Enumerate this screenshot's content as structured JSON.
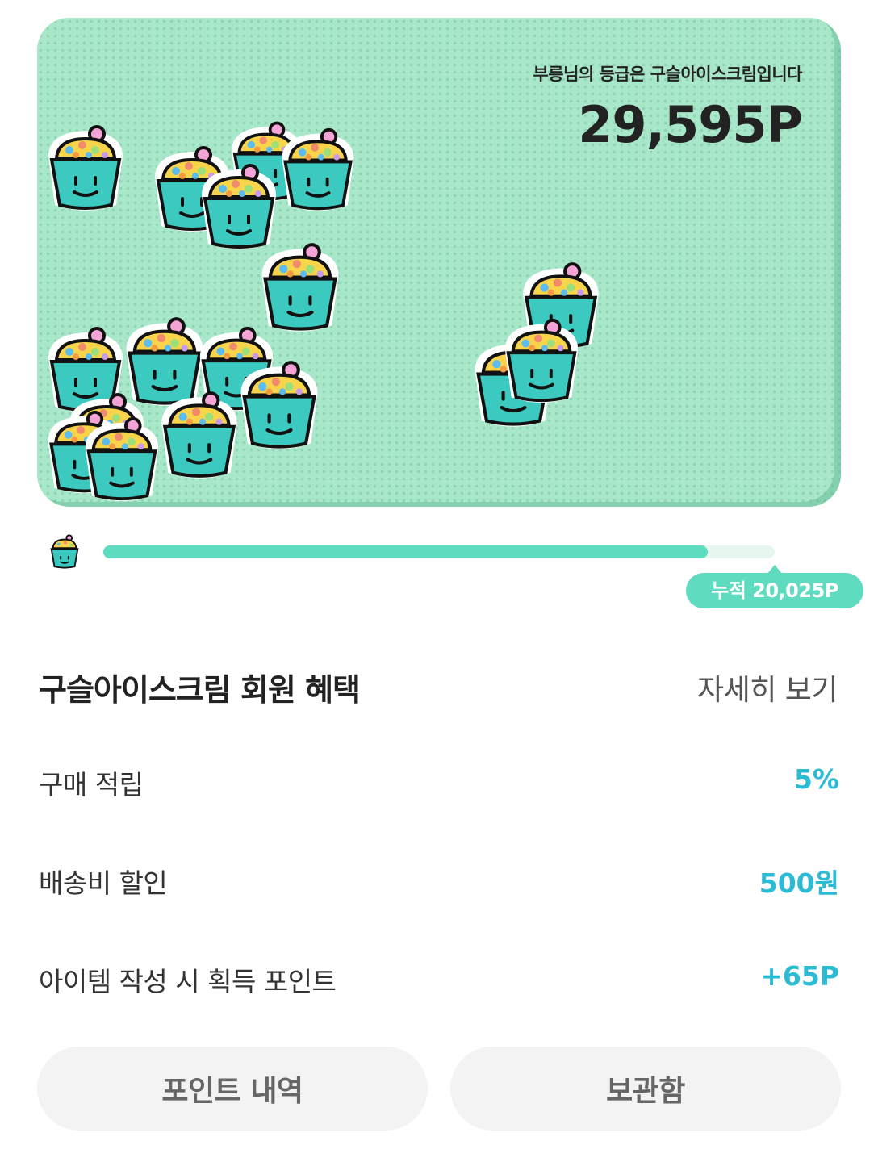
{
  "header": {
    "grade_text": "부릉님의 등급은 구슬아이스크림입니다",
    "points": "29,595P"
  },
  "progress": {
    "fill_fraction": 0.9,
    "cumulative_label": "누적 20,025P"
  },
  "benefits": {
    "title": "구슬아이스크림 회원 혜택",
    "more_label": "자세히 보기",
    "items": [
      {
        "label": "구매 적립",
        "value": "5%"
      },
      {
        "label": "배송비 할인",
        "value": "500원"
      },
      {
        "label": "아이템 작성 시 획득 포인트",
        "value": "+65P"
      }
    ]
  },
  "buttons": {
    "history_label": "포인트 내역",
    "storage_label": "보관함"
  },
  "icons": {
    "cup": "ice-cream-cup-icon"
  },
  "colors": {
    "card_bg": "#a8e7c9",
    "accent": "#5fdcbf",
    "value": "#2cbbd4",
    "cup_body": "#3cc9c0"
  }
}
